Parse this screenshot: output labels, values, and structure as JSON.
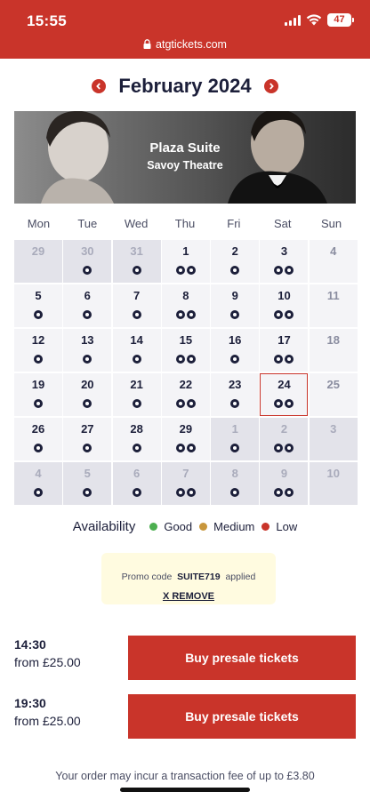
{
  "status_bar": {
    "time": "15:55",
    "battery": "47"
  },
  "browser": {
    "url": "atgtickets.com"
  },
  "calendar": {
    "month_label": "February 2024",
    "prev_icon": "chevron-left-icon",
    "next_icon": "chevron-right-icon",
    "weekdays": [
      "Mon",
      "Tue",
      "Wed",
      "Thu",
      "Fri",
      "Sat",
      "Sun"
    ],
    "weeks": [
      [
        {
          "day": "29",
          "dots": 0,
          "dim": true
        },
        {
          "day": "30",
          "dots": 1,
          "dim": true
        },
        {
          "day": "31",
          "dots": 1,
          "dim": true
        },
        {
          "day": "1",
          "dots": 2
        },
        {
          "day": "2",
          "dots": 1
        },
        {
          "day": "3",
          "dots": 2
        },
        {
          "day": "4",
          "dots": 0
        }
      ],
      [
        {
          "day": "5",
          "dots": 1
        },
        {
          "day": "6",
          "dots": 1
        },
        {
          "day": "7",
          "dots": 1
        },
        {
          "day": "8",
          "dots": 2
        },
        {
          "day": "9",
          "dots": 1
        },
        {
          "day": "10",
          "dots": 2
        },
        {
          "day": "11",
          "dots": 0
        }
      ],
      [
        {
          "day": "12",
          "dots": 1
        },
        {
          "day": "13",
          "dots": 1
        },
        {
          "day": "14",
          "dots": 1
        },
        {
          "day": "15",
          "dots": 2
        },
        {
          "day": "16",
          "dots": 1
        },
        {
          "day": "17",
          "dots": 2
        },
        {
          "day": "18",
          "dots": 0
        }
      ],
      [
        {
          "day": "19",
          "dots": 1
        },
        {
          "day": "20",
          "dots": 1
        },
        {
          "day": "21",
          "dots": 1
        },
        {
          "day": "22",
          "dots": 2
        },
        {
          "day": "23",
          "dots": 1
        },
        {
          "day": "24",
          "dots": 2,
          "selected": true
        },
        {
          "day": "25",
          "dots": 0
        }
      ],
      [
        {
          "day": "26",
          "dots": 1
        },
        {
          "day": "27",
          "dots": 1
        },
        {
          "day": "28",
          "dots": 1
        },
        {
          "day": "29",
          "dots": 2
        },
        {
          "day": "1",
          "dots": 1,
          "dim": true
        },
        {
          "day": "2",
          "dots": 2,
          "dim": true
        },
        {
          "day": "3",
          "dots": 0,
          "dim": true
        }
      ],
      [
        {
          "day": "4",
          "dots": 1,
          "dim": true
        },
        {
          "day": "5",
          "dots": 1,
          "dim": true
        },
        {
          "day": "6",
          "dots": 1,
          "dim": true
        },
        {
          "day": "7",
          "dots": 2,
          "dim": true
        },
        {
          "day": "8",
          "dots": 1,
          "dim": true
        },
        {
          "day": "9",
          "dots": 2,
          "dim": true
        },
        {
          "day": "10",
          "dots": 0,
          "dim": true
        }
      ]
    ]
  },
  "show": {
    "title": "Plaza Suite",
    "venue": "Savoy Theatre"
  },
  "legend": {
    "title": "Availability",
    "items": [
      {
        "label": "Good",
        "color": "#4caf50"
      },
      {
        "label": "Medium",
        "color": "#c8963c"
      },
      {
        "label": "Low",
        "color": "#c9342a"
      }
    ]
  },
  "promo": {
    "prefix": "Promo code",
    "code": "SUITE719",
    "suffix": "applied",
    "remove_label": "X REMOVE"
  },
  "performances": [
    {
      "time": "14:30",
      "price": "from £25.00",
      "button_label": "Buy presale tickets"
    },
    {
      "time": "19:30",
      "price": "from £25.00",
      "button_label": "Buy presale tickets"
    }
  ],
  "fee_notice": "Your order may incur a transaction fee of up to £3.80",
  "colors": {
    "brand": "#c9342a",
    "text": "#1c1f3a"
  }
}
